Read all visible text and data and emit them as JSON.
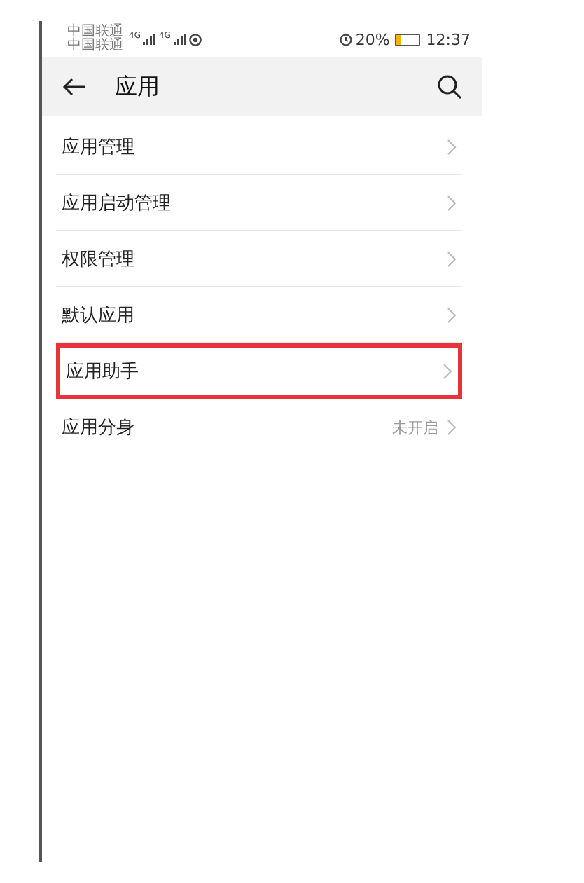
{
  "status_bar": {
    "carriers": [
      "中国联通",
      "中国联通"
    ],
    "signals": [
      "4G",
      "4G"
    ],
    "battery": "20%",
    "time": "12:37"
  },
  "header": {
    "title": "应用"
  },
  "rows": [
    {
      "label": "应用管理",
      "highlighted": false
    },
    {
      "label": "应用启动管理",
      "highlighted": false
    },
    {
      "label": "权限管理",
      "highlighted": false
    },
    {
      "label": "默认应用",
      "highlighted": false
    },
    {
      "label": "应用助手",
      "highlighted": true
    },
    {
      "label": "应用分身",
      "value": "未开启",
      "highlighted": false
    }
  ]
}
